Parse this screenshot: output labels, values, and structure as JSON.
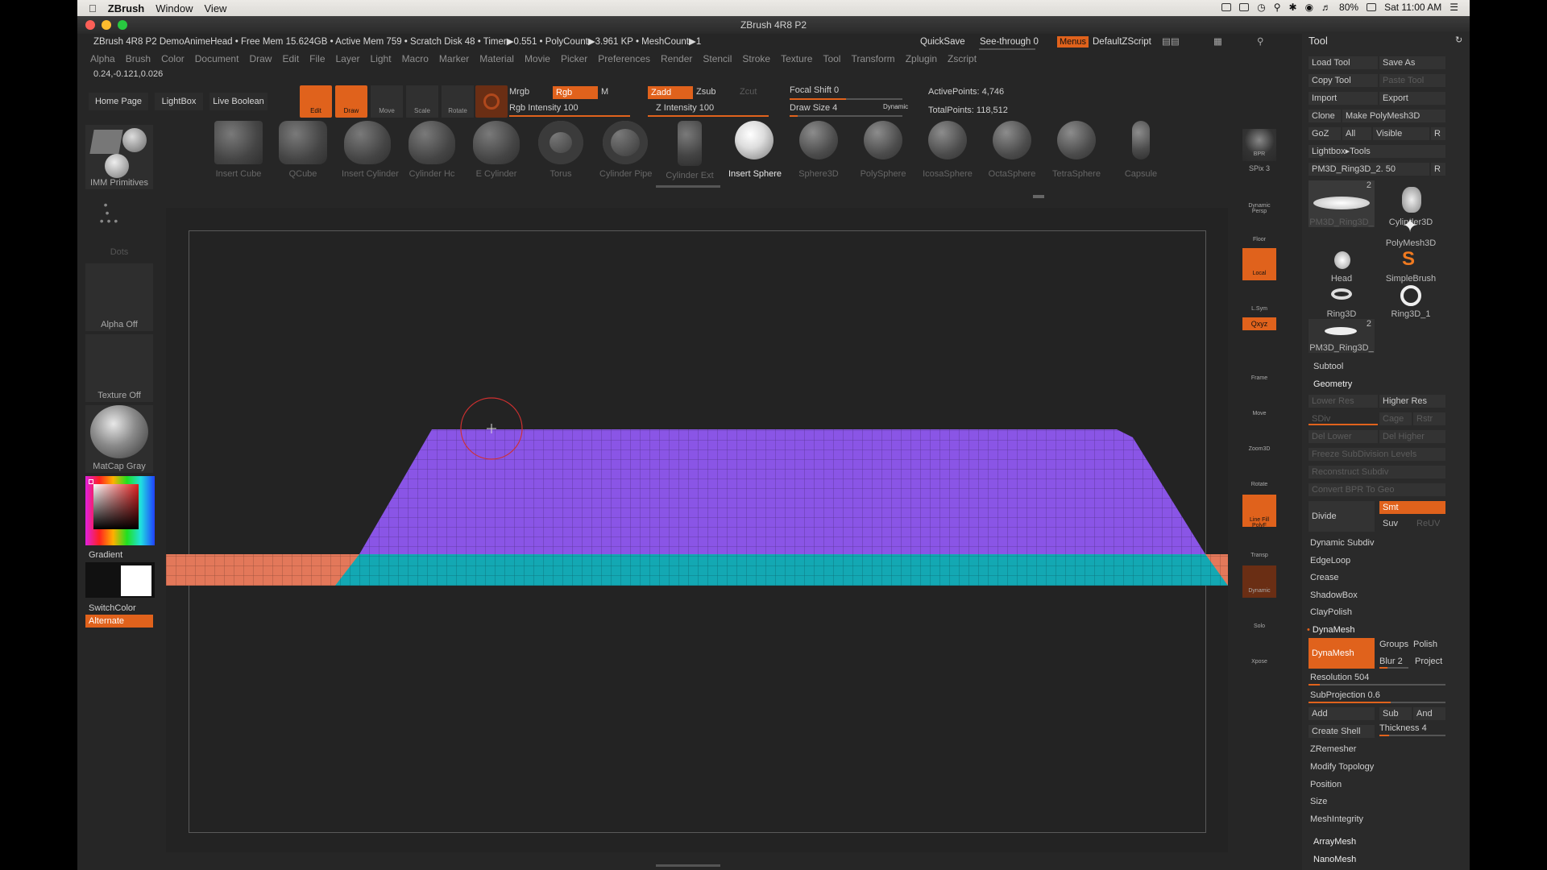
{
  "macbar": {
    "app": "ZBrush",
    "menus": [
      "Window",
      "View"
    ],
    "battery": "80%",
    "clock": "Sat 11:00 AM"
  },
  "window": {
    "title": "ZBrush 4R8 P2"
  },
  "infobar": {
    "text": "ZBrush 4R8 P2 DemoAnimeHead  • Free Mem 15.624GB • Active Mem 759 • Scratch Disk 48 •  Timer▶0.551 • PolyCount▶3.961 KP • MeshCount▶1",
    "quicksave": "QuickSave",
    "seethrough": "See-through  0",
    "menus": "Menus",
    "script": "DefaultZScript"
  },
  "menubar": [
    "Alpha",
    "Brush",
    "Color",
    "Document",
    "Draw",
    "Edit",
    "File",
    "Layer",
    "Light",
    "Macro",
    "Marker",
    "Material",
    "Movie",
    "Picker",
    "Preferences",
    "Render",
    "Stencil",
    "Stroke",
    "Texture",
    "Tool",
    "Transform",
    "Zplugin",
    "Zscript"
  ],
  "coords": "0.24,-0.121,0.026",
  "shelf": {
    "home": "Home Page",
    "lightbox": "LightBox",
    "liveboolean": "Live Boolean",
    "edit": "Edit",
    "draw": "Draw",
    "move": "Move",
    "scale": "Scale",
    "rotate": "Rotate",
    "mrgb": "Mrgb",
    "rgb": "Rgb",
    "m": "M",
    "zadd": "Zadd",
    "zsub": "Zsub",
    "zcut": "Zcut",
    "rgb_intensity": "Rgb Intensity 100",
    "z_intensity": "Z Intensity 100",
    "focal_shift": "Focal Shift 0",
    "draw_size": "Draw Size 4",
    "dynamic": "Dynamic",
    "active_points": "ActivePoints: 4,746",
    "total_points": "TotalPoints: 118,512"
  },
  "insert_tools": [
    {
      "name": "Insert Cube"
    },
    {
      "name": "QCube"
    },
    {
      "name": "Insert Cylinder"
    },
    {
      "name": "Cylinder Hc"
    },
    {
      "name": "E Cylinder"
    },
    {
      "name": "Torus"
    },
    {
      "name": "Cylinder Pipe"
    },
    {
      "name": "Cylinder Ext"
    },
    {
      "name": "Insert Sphere"
    },
    {
      "name": "Sphere3D"
    },
    {
      "name": "PolySphere"
    },
    {
      "name": "IcosaSphere"
    },
    {
      "name": "OctaSphere"
    },
    {
      "name": "TetraSphere"
    },
    {
      "name": "Capsule"
    }
  ],
  "leftpanel": {
    "brush": "IMM Primitives",
    "stroke": "Dots",
    "alpha": "Alpha Off",
    "texture": "Texture Off",
    "material": "MatCap Gray",
    "gradient": "Gradient",
    "switchcolor": "SwitchColor",
    "alternate": "Alternate"
  },
  "rightstrip": [
    "BPR",
    "SPix 3",
    "Dynamic Persp",
    "Floor",
    "Local",
    "L.Sym",
    "Qxyz",
    "Frame",
    "Move",
    "Zoom3D",
    "Rotate",
    "Line Fill PolyF",
    "Transp",
    "Dynamic",
    "Solo",
    "Xpose"
  ],
  "toolpanel": {
    "title": "Tool",
    "load": "Load Tool",
    "saveas": "Save As",
    "copy": "Copy Tool",
    "paste": "Paste Tool",
    "import": "Import",
    "export": "Export",
    "clone": "Clone",
    "makepoly": "Make PolyMesh3D",
    "goz": "GoZ",
    "all": "All",
    "visible": "Visible",
    "r": "R",
    "lightbox_tools": "Lightbox▸Tools",
    "current_tool": "PM3D_Ring3D_2. 50",
    "thumbs": [
      {
        "name": "PM3D_Ring3D_",
        "badge": "2"
      },
      {
        "name": "Cylinder3D",
        "badge": ""
      },
      {
        "name": "PolyMesh3D",
        "badge": ""
      },
      {
        "name": "Head",
        "badge": ""
      },
      {
        "name": "SimpleBrush",
        "badge": ""
      },
      {
        "name": "Ring3D",
        "badge": ""
      },
      {
        "name": "Ring3D_1",
        "badge": ""
      },
      {
        "name": "PM3D_Ring3D_",
        "badge": "2"
      }
    ],
    "subtool": "Subtool",
    "geometry": "Geometry",
    "lower_res": "Lower Res",
    "higher_res": "Higher Res",
    "sdiv": "SDiv",
    "cage": "Cage",
    "rstr": "Rstr",
    "del_lower": "Del Lower",
    "del_higher": "Del Higher",
    "freeze": "Freeze SubDivision Levels",
    "reconstruct": "Reconstruct Subdiv",
    "convert": "Convert BPR To Geo",
    "divide": "Divide",
    "smt": "Smt",
    "suv": "Suv",
    "reuv": "ReUV",
    "dynamic_subdiv": "Dynamic Subdiv",
    "edgeloop": "EdgeLoop",
    "crease": "Crease",
    "shadowbox": "ShadowBox",
    "claypolish": "ClayPolish",
    "dynamesh_header": "DynaMesh",
    "dynamesh_btn": "DynaMesh",
    "groups": "Groups",
    "polish": "Polish",
    "blur": "Blur 2",
    "project": "Project",
    "resolution": "Resolution 504",
    "subprojection": "SubProjection 0.6",
    "add": "Add",
    "sub": "Sub",
    "and": "And",
    "create_shell": "Create Shell",
    "thickness": "Thickness 4",
    "zremesher": "ZRemesher",
    "modify_topology": "Modify Topology",
    "position": "Position",
    "size": "Size",
    "meshintegrity": "MeshIntegrity",
    "arraymesh": "ArrayMesh",
    "nanomesh": "NanoMesh"
  },
  "colors": {
    "accent": "#e0621c",
    "mesh_purple": "#8a55e6",
    "mesh_teal": "#13a8b3",
    "mesh_salmon": "#e3785a"
  }
}
